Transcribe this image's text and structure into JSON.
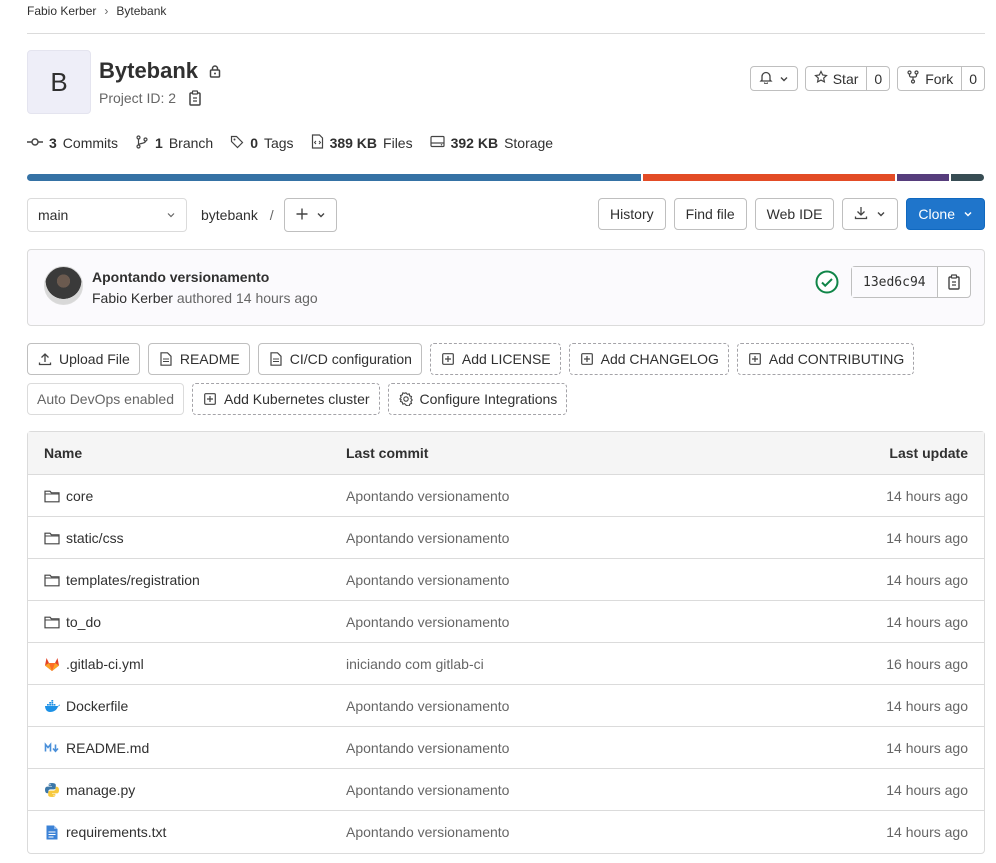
{
  "breadcrumb": {
    "owner": "Fabio Kerber",
    "project": "Bytebank"
  },
  "project": {
    "avatar_letter": "B",
    "name": "Bytebank",
    "id_label": "Project ID: 2"
  },
  "header_actions": {
    "star_label": "Star",
    "star_count": "0",
    "fork_label": "Fork",
    "fork_count": "0"
  },
  "stats": {
    "commits_count": "3",
    "commits_label": "Commits",
    "branches_count": "1",
    "branches_label": "Branch",
    "tags_count": "0",
    "tags_label": "Tags",
    "files_size": "389 KB",
    "files_label": "Files",
    "storage_size": "392 KB",
    "storage_label": "Storage"
  },
  "language_bar": [
    {
      "color": "#3572a5",
      "fraction": 0.645
    },
    {
      "color": "#e34c26",
      "fraction": 0.265
    },
    {
      "color": "#563d7c",
      "fraction": 0.055
    },
    {
      "color": "#384d54",
      "fraction": 0.035
    }
  ],
  "toolbar": {
    "branch": "main",
    "path": "bytebank",
    "path_sep": "/",
    "history": "History",
    "find_file": "Find file",
    "web_ide": "Web IDE",
    "clone": "Clone"
  },
  "last_commit": {
    "message": "Apontando versionamento",
    "author": "Fabio Kerber",
    "authored": "authored 14 hours ago",
    "sha": "13ed6c94"
  },
  "quick_actions_row1": [
    {
      "label": "Upload File",
      "style": "solid",
      "icon": "upload-icon"
    },
    {
      "label": "README",
      "style": "solid",
      "icon": "document-icon"
    },
    {
      "label": "CI/CD configuration",
      "style": "solid",
      "icon": "document-icon"
    },
    {
      "label": "Add LICENSE",
      "style": "dashed",
      "icon": "plus-square-icon"
    },
    {
      "label": "Add CHANGELOG",
      "style": "dashed",
      "icon": "plus-square-icon"
    },
    {
      "label": "Add CONTRIBUTING",
      "style": "dashed",
      "icon": "plus-square-icon"
    }
  ],
  "quick_actions_row2": [
    {
      "label": "Auto DevOps enabled",
      "style": "muted",
      "icon": ""
    },
    {
      "label": "Add Kubernetes cluster",
      "style": "dashed",
      "icon": "plus-square-icon"
    },
    {
      "label": "Configure Integrations",
      "style": "dashed",
      "icon": "gear-icon"
    }
  ],
  "file_table": {
    "headers": {
      "name": "Name",
      "last_commit": "Last commit",
      "last_update": "Last update"
    },
    "rows": [
      {
        "name": "core",
        "icon": "folder-icon",
        "commit": "Apontando versionamento",
        "updated": "14 hours ago"
      },
      {
        "name": "static/css",
        "icon": "folder-icon",
        "commit": "Apontando versionamento",
        "updated": "14 hours ago"
      },
      {
        "name": "templates/registration",
        "icon": "folder-icon",
        "commit": "Apontando versionamento",
        "updated": "14 hours ago"
      },
      {
        "name": "to_do",
        "icon": "folder-icon",
        "commit": "Apontando versionamento",
        "updated": "14 hours ago"
      },
      {
        "name": ".gitlab-ci.yml",
        "icon": "gitlab-icon",
        "commit": "iniciando com gitlab-ci",
        "updated": "16 hours ago"
      },
      {
        "name": "Dockerfile",
        "icon": "docker-icon",
        "commit": "Apontando versionamento",
        "updated": "14 hours ago"
      },
      {
        "name": "README.md",
        "icon": "markdown-icon",
        "commit": "Apontando versionamento",
        "updated": "14 hours ago"
      },
      {
        "name": "manage.py",
        "icon": "python-icon",
        "commit": "Apontando versionamento",
        "updated": "14 hours ago"
      },
      {
        "name": "requirements.txt",
        "icon": "text-file-icon",
        "commit": "Apontando versionamento",
        "updated": "14 hours ago"
      }
    ]
  }
}
